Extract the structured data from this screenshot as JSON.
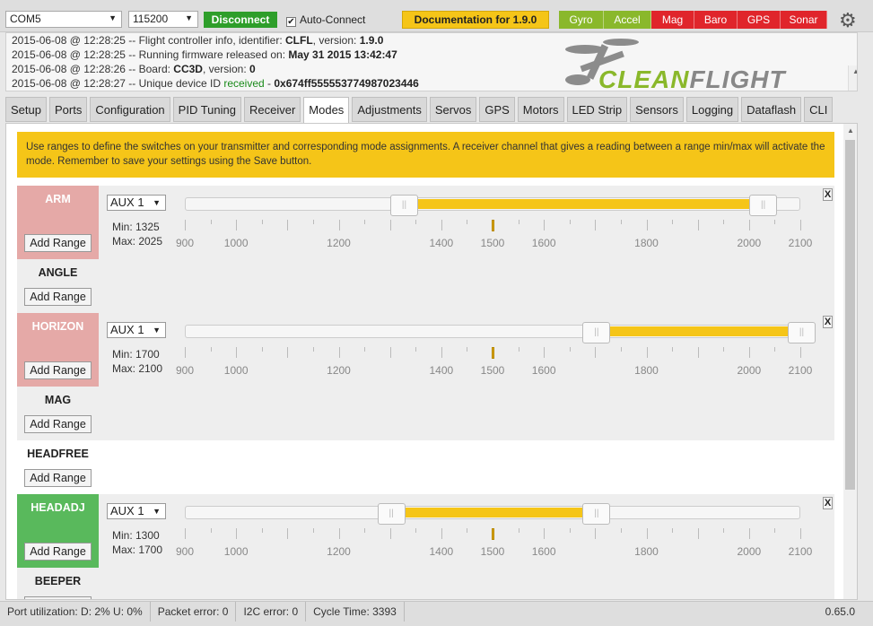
{
  "topbar": {
    "port": "COM5",
    "baud": "115200",
    "disconnect": "Disconnect",
    "auto_connect": "Auto-Connect",
    "auto_connect_checked": "✔",
    "documentation": "Documentation for 1.9.0",
    "sensors": [
      {
        "label": "Gyro",
        "color": "#8ab82b"
      },
      {
        "label": "Accel",
        "color": "#8ab82b"
      },
      {
        "label": "Mag",
        "color": "#e0252b"
      },
      {
        "label": "Baro",
        "color": "#e0252b"
      },
      {
        "label": "GPS",
        "color": "#e0252b"
      },
      {
        "label": "Sonar",
        "color": "#e0252b"
      }
    ]
  },
  "log": [
    {
      "prefix": "2015-06-08 @ 12:28:25 -- Flight controller info, identifier: ",
      "b1": "CLFL",
      "mid": ", version: ",
      "b2": "1.9.0",
      "green": "",
      "tail": ""
    },
    {
      "prefix": "2015-06-08 @ 12:28:25 -- Running firmware released on: ",
      "b1": "May 31 2015 13:42:47",
      "mid": "",
      "b2": "",
      "green": "",
      "tail": ""
    },
    {
      "prefix": "2015-06-08 @ 12:28:26 -- Board: ",
      "b1": "CC3D",
      "mid": ", version: ",
      "b2": "0",
      "green": "",
      "tail": ""
    },
    {
      "prefix": "2015-06-08 @ 12:28:27 -- Unique device ID ",
      "b1": "",
      "mid": "",
      "b2": "",
      "green": "received",
      "tail": " - ",
      "b3": "0x674ff555553774987023446"
    }
  ],
  "logo_text": "CLEANFLIGHT",
  "tabs": [
    "Setup",
    "Ports",
    "Configuration",
    "PID Tuning",
    "Receiver",
    "Modes",
    "Adjustments",
    "Servos",
    "GPS",
    "Motors",
    "LED Strip",
    "Sensors",
    "Logging",
    "Dataflash",
    "CLI"
  ],
  "active_tab": "Modes",
  "note": "Use ranges to define the switches on your transmitter and corresponding mode assignments. A receiver channel that gives a reading between a range min/max will activate the mode. Remember to save your settings using the Save button.",
  "add_range": "Add Range",
  "remove": "X",
  "scale_labels": [
    "900",
    "1000",
    "1200",
    "1400",
    "1500",
    "1600",
    "1800",
    "2000",
    "2100"
  ],
  "channel_marker": 1500,
  "modes": [
    {
      "name": "ARM",
      "state": "pink",
      "range": {
        "channel": "AUX 1",
        "min_label": "Min: 1325",
        "max_label": "Max: 2025",
        "min": 1325,
        "max": 2025
      }
    },
    {
      "name": "ANGLE",
      "state": "off"
    },
    {
      "name": "HORIZON",
      "state": "pink",
      "range": {
        "channel": "AUX 1",
        "min_label": "Min: 1700",
        "max_label": "Max: 2100",
        "min": 1700,
        "max": 2100
      }
    },
    {
      "name": "MAG",
      "state": "off"
    },
    {
      "name": "HEADFREE",
      "state": "off"
    },
    {
      "name": "HEADADJ",
      "state": "green",
      "range": {
        "channel": "AUX 1",
        "min_label": "Min: 1300",
        "max_label": "Max: 1700",
        "min": 1300,
        "max": 1700
      }
    },
    {
      "name": "BEEPER",
      "state": "off"
    }
  ],
  "status": {
    "port_util": "Port utilization: D: 2% U: 0%",
    "packet_error": "Packet error: 0",
    "i2c_error": "I2C error: 0",
    "cycle_time": "Cycle Time: 3393",
    "version": "0.65.0"
  }
}
